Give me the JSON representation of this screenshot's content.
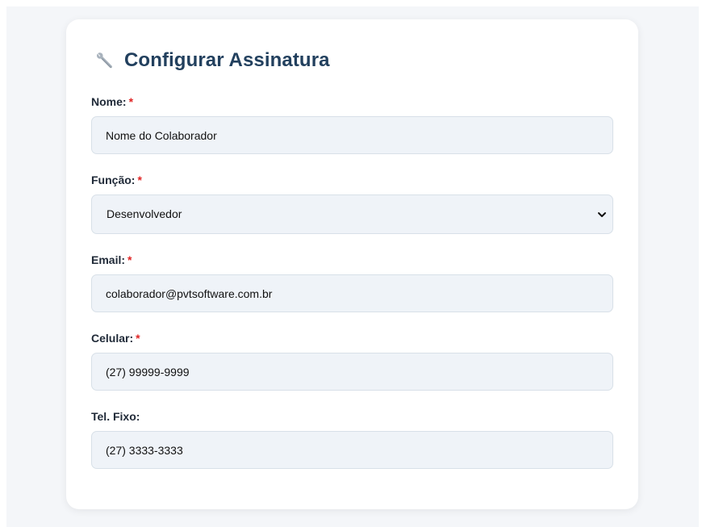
{
  "form": {
    "title": "Configurar Assinatura",
    "title_icon": "wrench-icon",
    "required_marker": "*",
    "fields": {
      "nome": {
        "label": "Nome:",
        "value": "Nome do Colaborador",
        "required": true
      },
      "funcao": {
        "label": "Função:",
        "value": "Desenvolvedor",
        "required": true
      },
      "email": {
        "label": "Email:",
        "value": "colaborador@pvtsoftware.com.br",
        "required": true
      },
      "celular": {
        "label": "Celular:",
        "value": "(27) 99999-9999",
        "required": true
      },
      "tel_fixo": {
        "label": "Tel. Fixo:",
        "value": "(27) 3333-3333",
        "required": false
      }
    }
  },
  "colors": {
    "title": "#22405e",
    "required": "#e02424",
    "input_bg": "#eff3f8",
    "input_border": "#d8e0e8",
    "page_bg": "#f4f6f9"
  }
}
